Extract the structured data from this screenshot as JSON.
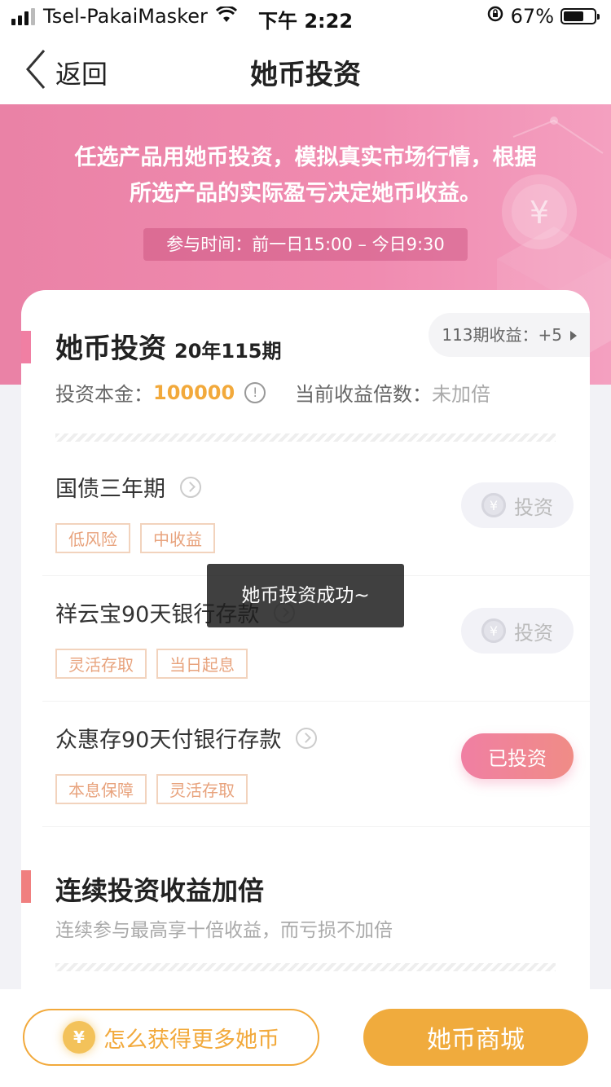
{
  "status_bar": {
    "carrier": "Tsel-PakaiMasker",
    "time": "下午 2:22",
    "battery_text": "67%",
    "battery_level": 0.67
  },
  "nav": {
    "back_label": "返回",
    "title": "她币投资"
  },
  "banner": {
    "line1": "任选产品用她币投资，模拟真实市场行情，根据",
    "line2": "所选产品的实际盈亏决定她币收益。",
    "time_label": "参与时间：前一日15:00 – 今日9:30"
  },
  "card": {
    "title": "她币投资",
    "issue": "20年115期",
    "prev_earnings": "113期收益：+5",
    "principal_label": "投资本金：",
    "principal_value": "100000",
    "multiplier_label": "当前收益倍数：",
    "multiplier_value": "未加倍"
  },
  "products": [
    {
      "name": "国债三年期",
      "tags": [
        "低风险",
        "中收益"
      ],
      "button": "投资",
      "invested": false
    },
    {
      "name": "祥云宝90天银行存款",
      "tags": [
        "灵活存取",
        "当日起息"
      ],
      "button": "投资",
      "invested": false
    },
    {
      "name": "众惠存90天付银行存款",
      "tags": [
        "本息保障",
        "灵活存取"
      ],
      "button": "已投资",
      "invested": true
    }
  ],
  "section2": {
    "title": "连续投资收益加倍",
    "subtitle": "连续参与最高享十倍收益，而亏损不加倍"
  },
  "toast": "她币投资成功~",
  "bottom": {
    "earn_more": "怎么获得更多她币",
    "mall": "她币商城",
    "coin_symbol": "¥"
  },
  "colors": {
    "brand_pink": "#f07fa3",
    "gold": "#f2a93b"
  }
}
